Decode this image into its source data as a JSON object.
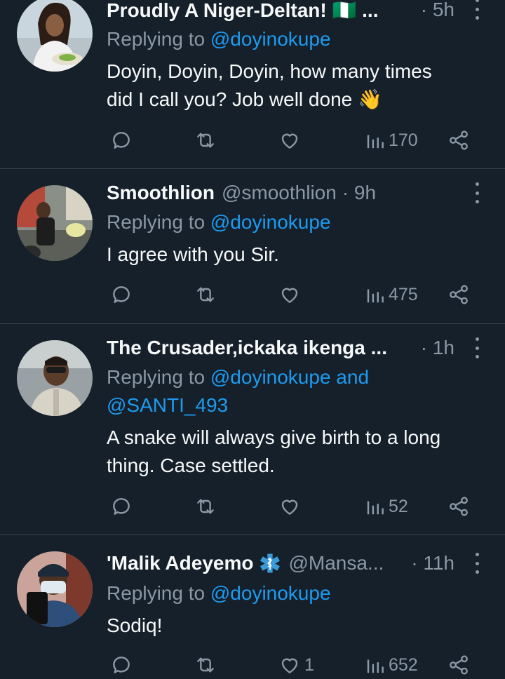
{
  "colors": {
    "background": "#15202b",
    "text": "#f7f9f9",
    "muted": "#8b98a5",
    "link": "#1d9bf0",
    "divider": "#38444d"
  },
  "tweets": [
    {
      "name": "Proudly A Niger-Deltan! 🇳🇬 ...",
      "handle": "",
      "time": "· 5h",
      "replying_prefix": "Replying to ",
      "replying_to": "@doyinokupe",
      "text_line1": "Doyin, Doyin, Doyin, how many times",
      "text_line2": "did I call you? Job well done 👋",
      "views": "170",
      "likes": ""
    },
    {
      "name": "Smoothlion",
      "handle": "@smoothlion",
      "time": "· 9h",
      "replying_prefix": "Replying to ",
      "replying_to": "@doyinokupe",
      "text_line1": "I agree with you Sir.",
      "views": "475",
      "likes": ""
    },
    {
      "name": "The Crusader,ickaka ikenga ...",
      "handle": "",
      "time": "· 1h",
      "replying_prefix": "Replying to ",
      "replying_to": "@doyinokupe and",
      "replying_to_line2": "@SANTI_493",
      "text_line1": "A snake will always give birth to a long",
      "text_line2": "thing. Case settled.",
      "views": "52",
      "likes": ""
    },
    {
      "name": "'Malik Adeyemo",
      "handle": "@Mansa...",
      "time": "· 11h",
      "replying_prefix": "Replying to ",
      "replying_to": "@doyinokupe",
      "text_line1": "Sodiq!",
      "views": "652",
      "likes": "1"
    }
  ]
}
